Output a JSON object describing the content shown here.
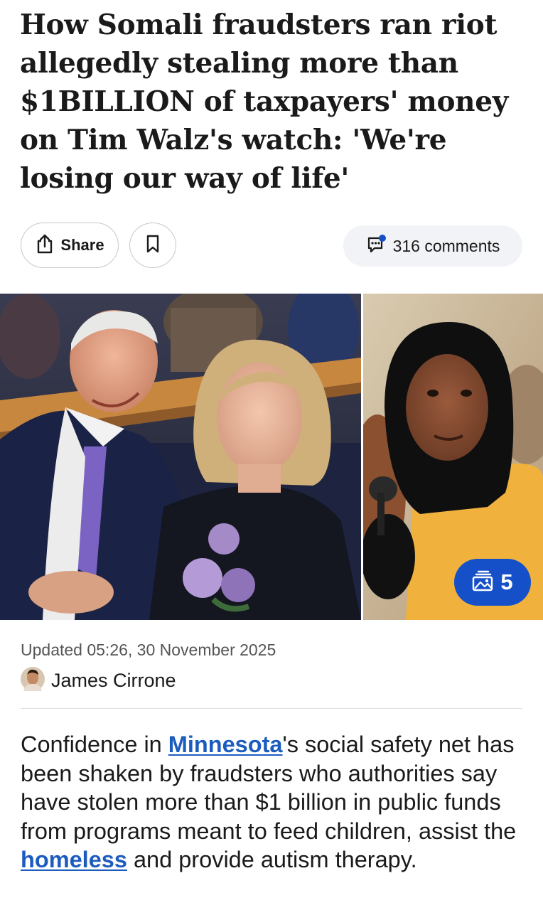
{
  "article": {
    "headline": "How Somali fraudsters ran riot allegedly stealing more than $1BILLION of taxpayers' money on Tim Walz's watch: 'We're losing our way of life'",
    "updated": "Updated 05:26, 30 November 2025",
    "author": "James Cirrone",
    "body": {
      "p1_before_link1": "Confidence in ",
      "link1": "Minnesota",
      "p1_between": "'s social safety net has been shaken by fraudsters who authorities say have stolen more than $1 billion in public funds from programs meant to feed children, assist the ",
      "link2": "homeless",
      "p1_after_link2": " and provide autism therapy."
    }
  },
  "actions": {
    "share_label": "Share",
    "comments_label": "316 comments",
    "share_icon": "share-icon",
    "bookmark_icon": "bookmark-icon",
    "comments_icon": "comment-bubble-icon"
  },
  "gallery": {
    "count": "5",
    "icon": "gallery-icon"
  },
  "colors": {
    "link": "#1d5cbf",
    "gallery_badge": "#1550c8",
    "comment_dot": "#1550c8"
  }
}
